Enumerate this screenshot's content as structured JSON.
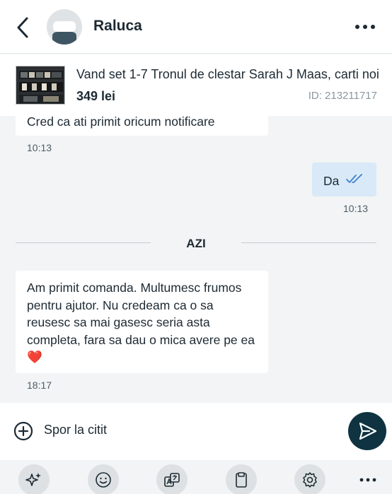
{
  "header": {
    "contact_name": "Raluca"
  },
  "product": {
    "title": "Vand set 1-7 Tronul de clestar Sarah J Maas, carti noi",
    "price": "349 lei",
    "id_label": "ID: 213211717"
  },
  "messages": [
    {
      "direction": "incoming",
      "text": "Cred ca ati primit oricum notificare",
      "time": "10:13"
    },
    {
      "direction": "outgoing",
      "text": "Da",
      "time": "10:13",
      "status": "read"
    },
    {
      "direction": "incoming",
      "text": "Am primit comanda. Multumesc frumos pentru ajutor. Nu credeam ca o sa reusesc sa mai gasesc seria asta completa, fara sa dau o mica avere pe ea",
      "emoji": "❤️",
      "time": "18:17"
    }
  ],
  "day_divider": "AZI",
  "composer": {
    "value": "Spor la citit"
  },
  "toolbar": [
    "sparkles-icon",
    "smiley-icon",
    "translate-icon",
    "clipboard-icon",
    "settings-icon",
    "more-icon"
  ],
  "colors": {
    "accent": "#0f3340",
    "outgoing_bubble": "#d9e9f7",
    "read_check": "#3f7fd0",
    "background": "#f2f4f5"
  }
}
